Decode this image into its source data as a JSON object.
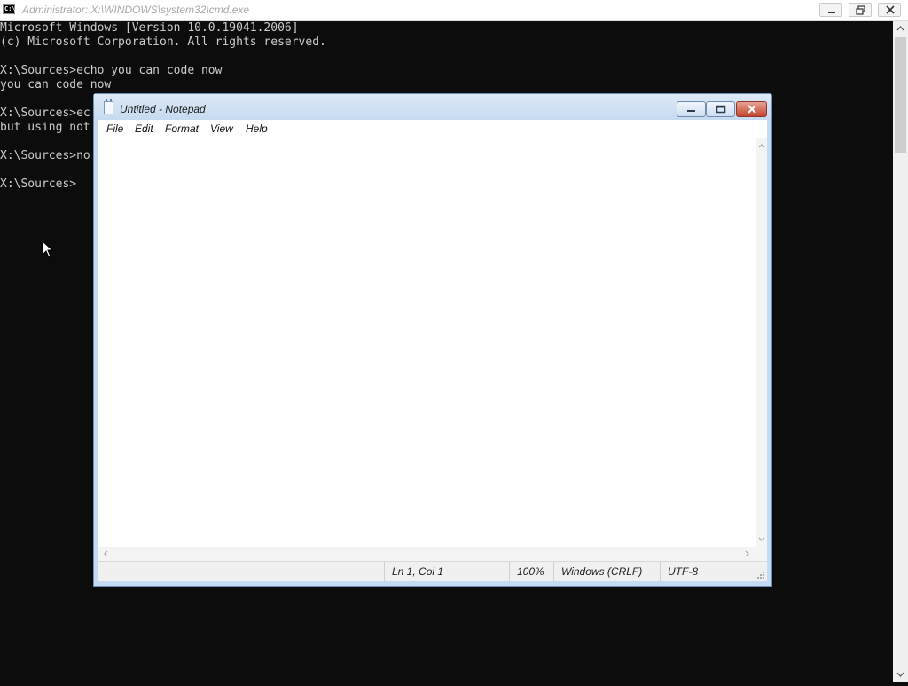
{
  "cmd": {
    "title": "Administrator: X:\\WINDOWS\\system32\\cmd.exe",
    "icon_text": "C:\\",
    "lines": [
      "Microsoft Windows [Version 10.0.19041.2006]",
      "(c) Microsoft Corporation. All rights reserved.",
      "",
      "X:\\Sources>echo you can code now",
      "you can code now",
      "",
      "X:\\Sources>ec",
      "but using not",
      "",
      "X:\\Sources>no",
      "",
      "X:\\Sources>"
    ]
  },
  "notepad": {
    "title": "Untitled - Notepad",
    "menu": [
      "File",
      "Edit",
      "Format",
      "View",
      "Help"
    ],
    "text": "",
    "status": {
      "position": "Ln 1, Col 1",
      "zoom": "100%",
      "line_ending": "Windows (CRLF)",
      "encoding": "UTF-8"
    }
  },
  "colors": {
    "console_bg": "#0c0c0c",
    "console_text": "#cccccc",
    "close_button": "#c4452d"
  }
}
